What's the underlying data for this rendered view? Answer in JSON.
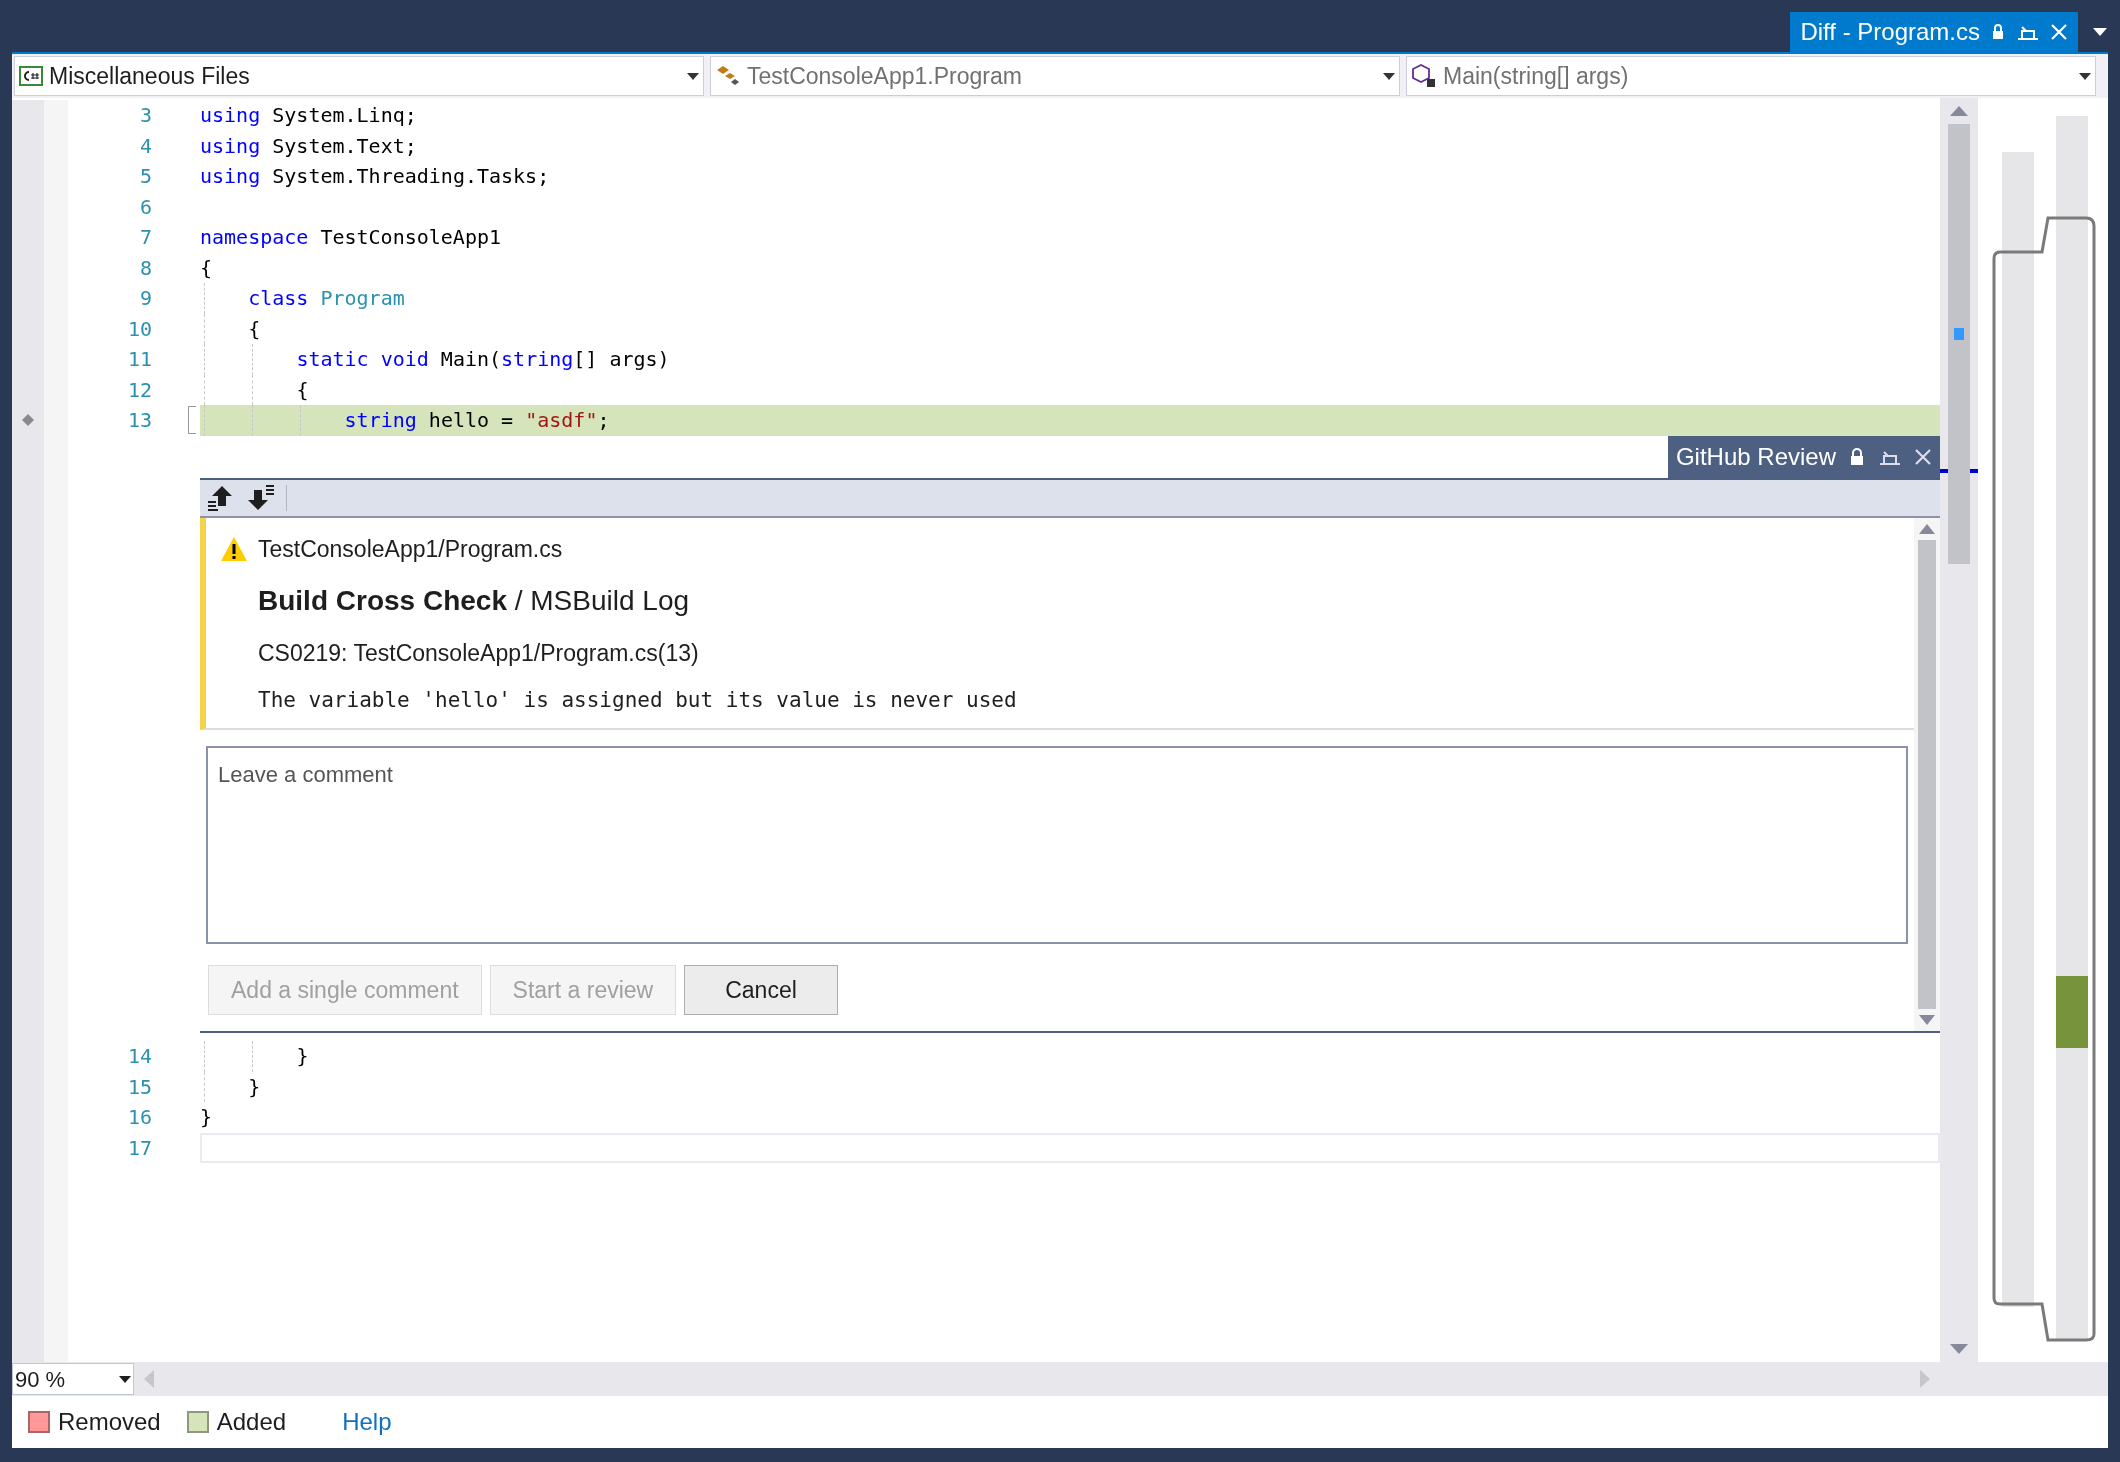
{
  "document_tab": {
    "title": "Diff - Program.cs"
  },
  "navigation_bar": [
    {
      "kind": "project",
      "label": "Miscellaneous Files"
    },
    {
      "kind": "type",
      "label": "TestConsoleApp1.Program"
    },
    {
      "kind": "member",
      "label": "Main(string[] args)"
    }
  ],
  "code_before": [
    {
      "number": "3",
      "changed": false,
      "tokens": [
        {
          "text": "using",
          "kind": "keyword"
        },
        {
          "text": " System.Linq;",
          "kind": "plain"
        }
      ]
    },
    {
      "number": "4",
      "changed": false,
      "tokens": [
        {
          "text": "using",
          "kind": "keyword"
        },
        {
          "text": " System.Text;",
          "kind": "plain"
        }
      ]
    },
    {
      "number": "5",
      "changed": false,
      "tokens": [
        {
          "text": "using",
          "kind": "keyword"
        },
        {
          "text": " System.Threading.Tasks;",
          "kind": "plain"
        }
      ]
    },
    {
      "number": "6",
      "changed": false
    },
    {
      "number": "7",
      "changed": false,
      "tokens": [
        {
          "text": "namespace",
          "kind": "keyword"
        },
        {
          "text": " TestConsoleApp1",
          "kind": "plain"
        }
      ]
    },
    {
      "number": "8",
      "changed": false,
      "tokens": [
        {
          "text": "{",
          "kind": "plain"
        }
      ]
    },
    {
      "number": "9",
      "changed": false,
      "tokens": [
        {
          "text": "class ",
          "kind": "keyword"
        },
        {
          "text": "Program",
          "kind": "type"
        }
      ]
    },
    {
      "number": "10",
      "changed": false,
      "tokens": [
        {
          "text": "{",
          "kind": "plain"
        }
      ]
    },
    {
      "number": "11",
      "changed": false,
      "tokens": [
        {
          "text": "static void",
          "kind": "keyword"
        },
        {
          "text": " Main(",
          "kind": "plain"
        },
        {
          "text": "string",
          "kind": "keyword"
        },
        {
          "text": "[] args)",
          "kind": "plain"
        }
      ]
    },
    {
      "number": "12",
      "changed": false,
      "tokens": [
        {
          "text": "{",
          "kind": "plain"
        }
      ]
    },
    {
      "number": "13",
      "changed": true,
      "tokens": [
        {
          "text": "string",
          "kind": "keyword"
        },
        {
          "text": " hello = ",
          "kind": "plain"
        },
        {
          "text": "\"asdf\"",
          "kind": "string"
        },
        {
          "text": ";",
          "kind": "plain"
        }
      ]
    }
  ],
  "review_panel": {
    "title": "GitHub Review",
    "file": "TestConsoleApp1/Program.cs",
    "heading": "**Build Cross Check** / MSBuild Log",
    "location": "CS0219: TestConsoleApp1/Program.cs(13)",
    "message": "The variable 'hello' is assigned but its value is never used",
    "comment": {
      "placeholder": "Leave a comment"
    },
    "buttons": [
      {
        "label": "Add a single comment",
        "disabled": true
      },
      {
        "label": "Start a review",
        "disabled": true
      },
      {
        "label": "Cancel",
        "disabled": false
      }
    ]
  },
  "code_after": [
    {
      "number": "14",
      "changed": false,
      "tokens": [
        {
          "text": "}",
          "kind": "plain"
        }
      ]
    },
    {
      "number": "15",
      "changed": false,
      "tokens": [
        {
          "text": "}",
          "kind": "plain"
        }
      ]
    },
    {
      "number": "16",
      "changed": false,
      "tokens": [
        {
          "text": "}",
          "kind": "plain"
        }
      ]
    },
    {
      "number": "17",
      "changed": false
    }
  ],
  "zoom": "90 %",
  "legend": [
    {
      "label": "Removed",
      "color": "#ff9999"
    },
    {
      "label": "Added",
      "color": "#d6e4bc"
    }
  ],
  "help_link": "Help"
}
